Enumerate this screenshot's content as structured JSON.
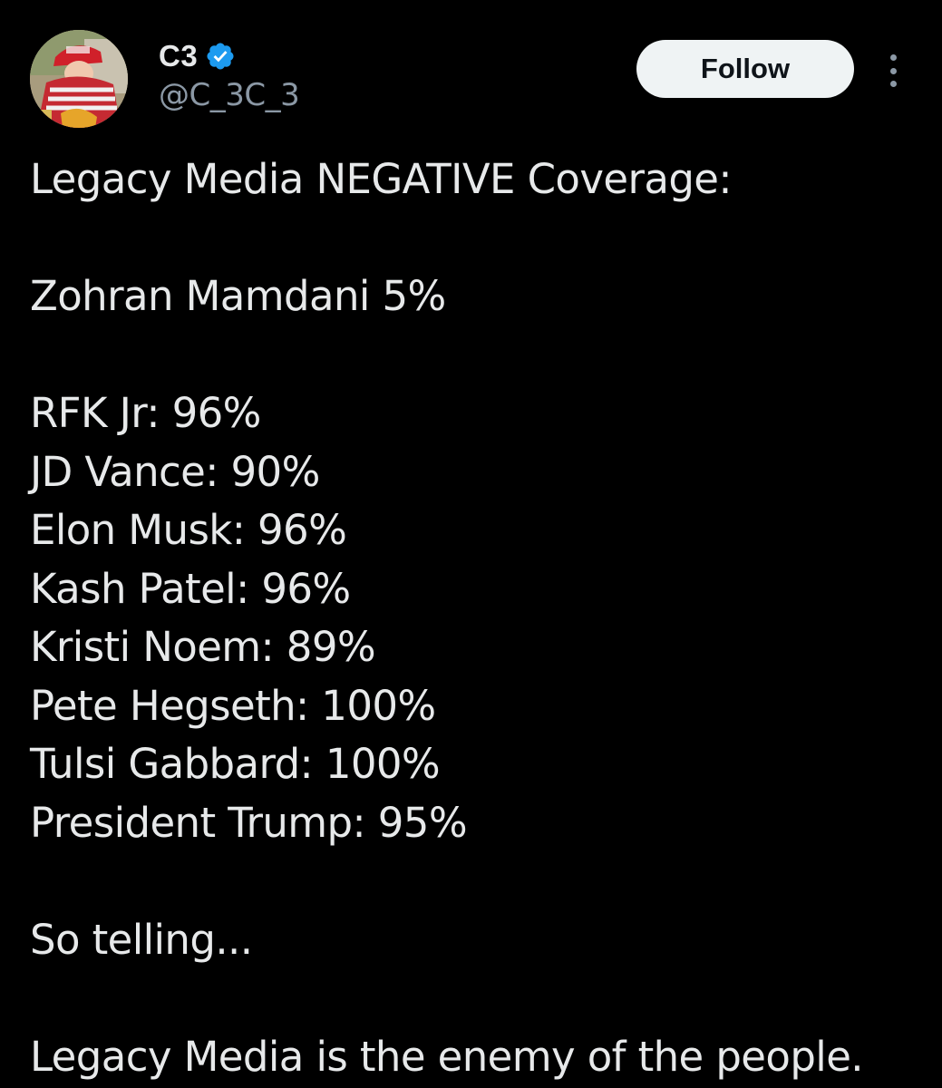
{
  "author": {
    "display_name": "C3",
    "handle": "@C_3C_3",
    "verified_icon": "verified-badge-icon",
    "avatar_icon": "profile-photo"
  },
  "actions": {
    "follow_label": "Follow",
    "more_icon": "more-options-icon"
  },
  "colors": {
    "background": "#000000",
    "text": "#e7e9ea",
    "secondary_text": "#8b98a5",
    "verified_blue": "#1d9bf0",
    "button_bg": "#eff3f4"
  },
  "post": {
    "heading": "Legacy Media NEGATIVE Coverage:",
    "highlight": "Zohran Mamdani 5%",
    "items": [
      "RFK Jr: 96%",
      "JD Vance: 90%",
      "Elon Musk: 96%",
      "Kash Patel: 96%",
      "Kristi Noem: 89%",
      "Pete Hegseth: 100%",
      "Tulsi Gabbard: 100%",
      "President Trump: 95%"
    ],
    "comment": "So telling...",
    "closing": "Legacy Media is the enemy of the people."
  }
}
